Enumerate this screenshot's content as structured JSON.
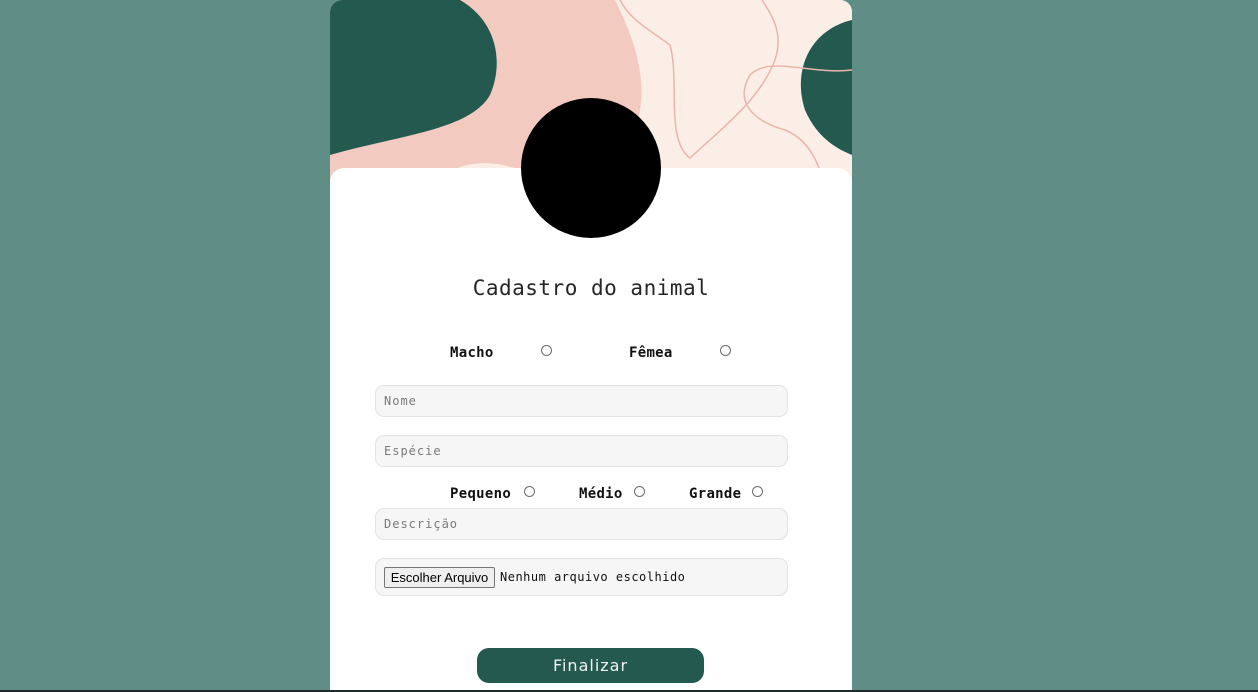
{
  "form": {
    "title": "Cadastro do animal",
    "sex_options": [
      "Macho",
      "Fêmea"
    ],
    "name_placeholder": "Nome",
    "species_placeholder": "Espécie",
    "size_options": [
      "Pequeno",
      "Médio",
      "Grande"
    ],
    "description_placeholder": "Descrição",
    "file_button_label": "Escolher Arquivo",
    "file_status": "Nenhum arquivo escolhido",
    "submit_label": "Finalizar"
  },
  "colors": {
    "background": "#608d86",
    "accent_dark_green": "#245950",
    "blob_peach": "#f2cabf",
    "blob_cream": "#fbeee6"
  }
}
